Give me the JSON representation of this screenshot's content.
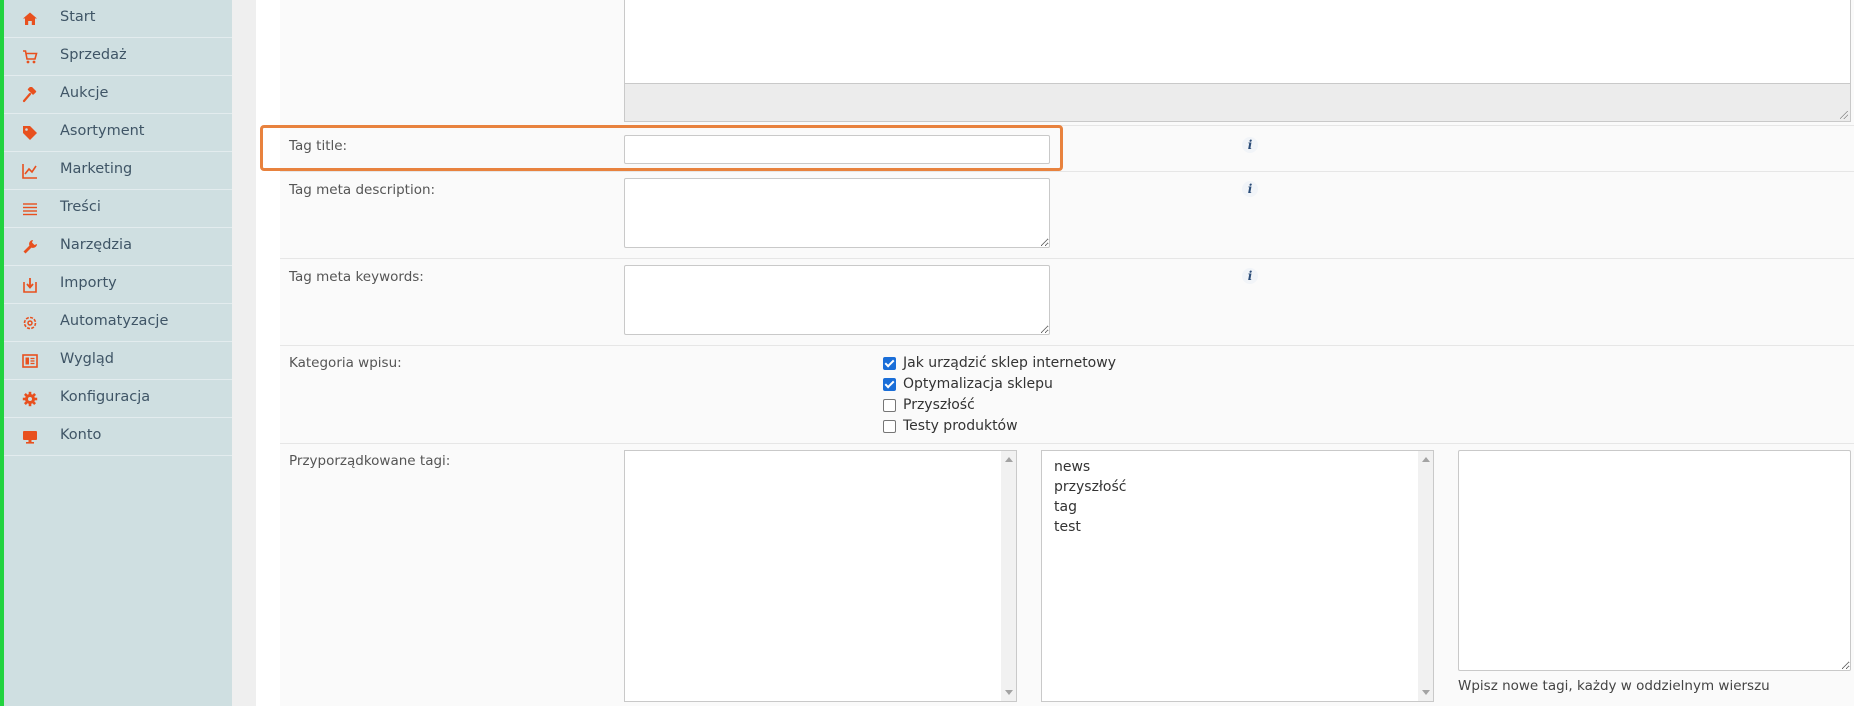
{
  "sidebar": {
    "items": [
      {
        "label": "Start",
        "icon": "home-icon"
      },
      {
        "label": "Sprzedaż",
        "icon": "cart-icon"
      },
      {
        "label": "Aukcje",
        "icon": "gavel-icon"
      },
      {
        "label": "Asortyment",
        "icon": "tag-icon"
      },
      {
        "label": "Marketing",
        "icon": "chart-line-icon"
      },
      {
        "label": "Treści",
        "icon": "list-icon"
      },
      {
        "label": "Narzędzia",
        "icon": "wrench-icon"
      },
      {
        "label": "Importy",
        "icon": "import-icon"
      },
      {
        "label": "Automatyzacje",
        "icon": "cog-outline-icon"
      },
      {
        "label": "Wygląd",
        "icon": "layout-icon"
      },
      {
        "label": "Konfiguracja",
        "icon": "gear-icon"
      },
      {
        "label": "Konto",
        "icon": "monitor-icon"
      }
    ],
    "accent_color": "#e8501e"
  },
  "form": {
    "tag_title": {
      "label": "Tag title:",
      "value": ""
    },
    "meta_description": {
      "label": "Tag meta description:",
      "value": ""
    },
    "meta_keywords": {
      "label": "Tag meta keywords:",
      "value": ""
    },
    "category": {
      "label": "Kategoria wpisu:",
      "options": [
        {
          "label": "Jak urządzić sklep internetowy",
          "checked": true
        },
        {
          "label": "Optymalizacja sklepu",
          "checked": true
        },
        {
          "label": "Przyszłość",
          "checked": false
        },
        {
          "label": "Testy produktów",
          "checked": false
        }
      ]
    },
    "tags": {
      "label": "Przyporządkowane tagi:",
      "assigned": [],
      "available": [
        "news",
        "przyszłość",
        "tag",
        "test"
      ],
      "new_tags_hint": "Wpisz nowe tagi, każdy w oddzielnym wierszu"
    }
  },
  "highlight_color": "#e8823e"
}
